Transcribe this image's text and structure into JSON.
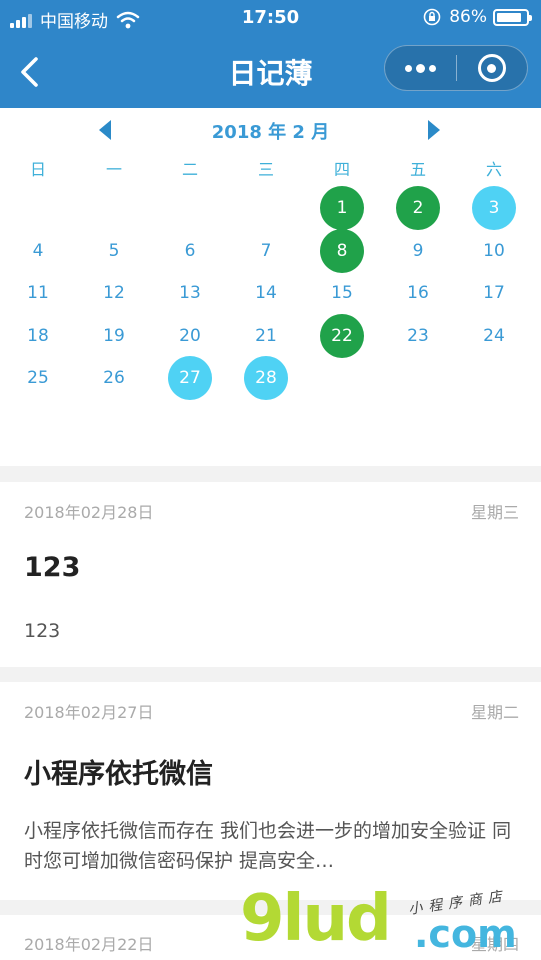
{
  "status_bar": {
    "carrier": "中国移动",
    "time": "17:50",
    "battery_percent": "86%",
    "battery_level": 0.86
  },
  "nav": {
    "title": "日记薄",
    "back_icon": "chevron-left-icon",
    "more_icon": "more-dots-icon",
    "close_icon": "target-close-icon"
  },
  "calendar": {
    "month_label": "2018 年 2 月",
    "weekdays": [
      "日",
      "一",
      "二",
      "三",
      "四",
      "五",
      "六"
    ],
    "first_weekday_index": 4,
    "days": [
      {
        "d": "1",
        "mark": "green"
      },
      {
        "d": "2",
        "mark": "green"
      },
      {
        "d": "3",
        "mark": "cyan"
      },
      {
        "d": "4"
      },
      {
        "d": "5"
      },
      {
        "d": "6"
      },
      {
        "d": "7"
      },
      {
        "d": "8",
        "mark": "green"
      },
      {
        "d": "9"
      },
      {
        "d": "10"
      },
      {
        "d": "11"
      },
      {
        "d": "12"
      },
      {
        "d": "13"
      },
      {
        "d": "14"
      },
      {
        "d": "15"
      },
      {
        "d": "16"
      },
      {
        "d": "17"
      },
      {
        "d": "18"
      },
      {
        "d": "19"
      },
      {
        "d": "20"
      },
      {
        "d": "21"
      },
      {
        "d": "22",
        "mark": "green"
      },
      {
        "d": "23"
      },
      {
        "d": "24"
      },
      {
        "d": "25"
      },
      {
        "d": "26"
      },
      {
        "d": "27",
        "mark": "cyan"
      },
      {
        "d": "28",
        "mark": "cyan"
      }
    ],
    "colors": {
      "text": "#3a9ad5",
      "green": "#20a24a",
      "cyan": "#4fd2f4"
    }
  },
  "entries": [
    {
      "date": "2018年02月28日",
      "weekday": "星期三",
      "title": "123",
      "body": "123"
    },
    {
      "date": "2018年02月27日",
      "weekday": "星期二",
      "title": "小程序依托微信",
      "body": "小程序依托微信而存在 我们也会进一步的增加安全验证 同时您可增加微信密码保护 提高安全…"
    },
    {
      "date": "2018年02月22日",
      "weekday": "星期四"
    }
  ],
  "watermark": {
    "brand": "9lud",
    "domain": ".com",
    "tagline": "小程序商店"
  },
  "colors": {
    "header_bg": "#2f86c9",
    "page_bg": "#f2f2f2"
  }
}
